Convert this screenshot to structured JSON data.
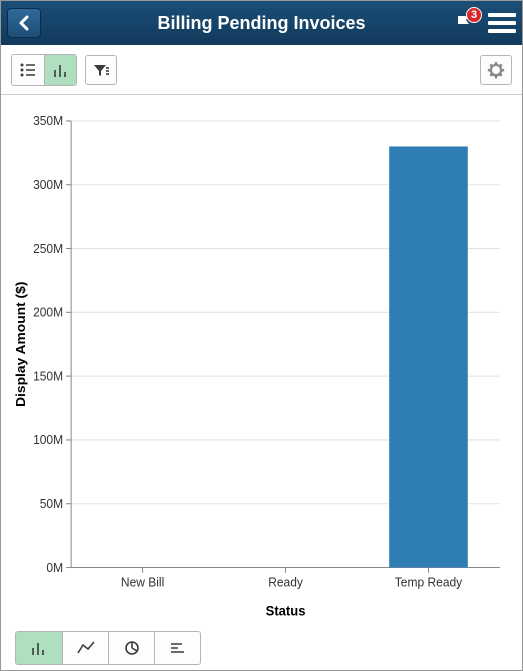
{
  "header": {
    "title": "Billing Pending Invoices",
    "notification_count": "3"
  },
  "toolbar": {
    "view_list": "list",
    "view_chart": "chart",
    "filter": "filter",
    "settings": "settings"
  },
  "chart_data": {
    "type": "bar",
    "categories": [
      "New Bill",
      "Ready",
      "Temp Ready"
    ],
    "values": [
      0,
      0,
      330000000
    ],
    "title": "",
    "xlabel": "Status",
    "ylabel": "Display Amount ($)",
    "ylim": [
      0,
      350000000
    ],
    "ytick_step": 50000000,
    "ytick_labels": [
      "0M",
      "50M",
      "100M",
      "150M",
      "200M",
      "250M",
      "300M",
      "350M"
    ]
  },
  "chart_types": {
    "bar": "bar",
    "line": "line",
    "pie": "pie",
    "hbar": "horizontal-bar"
  }
}
